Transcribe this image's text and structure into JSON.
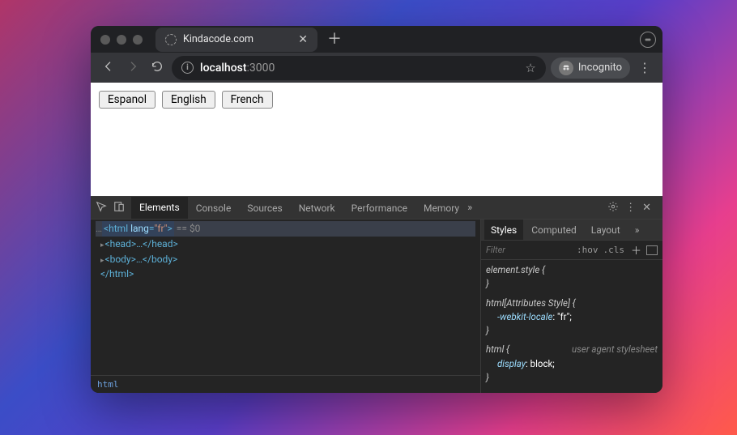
{
  "tab": {
    "title": "Kindacode.com"
  },
  "address": {
    "host": "localhost",
    "port": ":3000"
  },
  "incognito": {
    "label": "Incognito"
  },
  "page": {
    "buttons": {
      "espanol": "Espanol",
      "english": "English",
      "french": "French"
    }
  },
  "devtools": {
    "tabs": {
      "elements": "Elements",
      "console": "Console",
      "sources": "Sources",
      "network": "Network",
      "performance": "Performance",
      "memory": "Memory"
    },
    "dom": {
      "open_html_pre": "<html ",
      "open_html_attr": "lang",
      "open_html_val": "\"fr\"",
      "open_html_post": ">",
      "eq_end": " == $0",
      "head": "<head>…</head>",
      "body": "<body>…</body>",
      "close_html": "</html>"
    },
    "breadcrumb": "html",
    "styles": {
      "tabs": {
        "styles": "Styles",
        "computed": "Computed",
        "layout": "Layout"
      },
      "filter_placeholder": "Filter",
      "hov": ":hov",
      "cls": ".cls",
      "rule1_sel": "element.style {",
      "rule1_close": "}",
      "rule2_sel": "html[Attributes Style] {",
      "rule2_prop": "-webkit-locale",
      "rule2_val": ": \"fr\";",
      "rule2_close": "}",
      "rule3_sel": "html {",
      "rule3_uas": "user agent stylesheet",
      "rule3_prop": "display",
      "rule3_val": ": block;",
      "rule3_close": "}"
    }
  }
}
